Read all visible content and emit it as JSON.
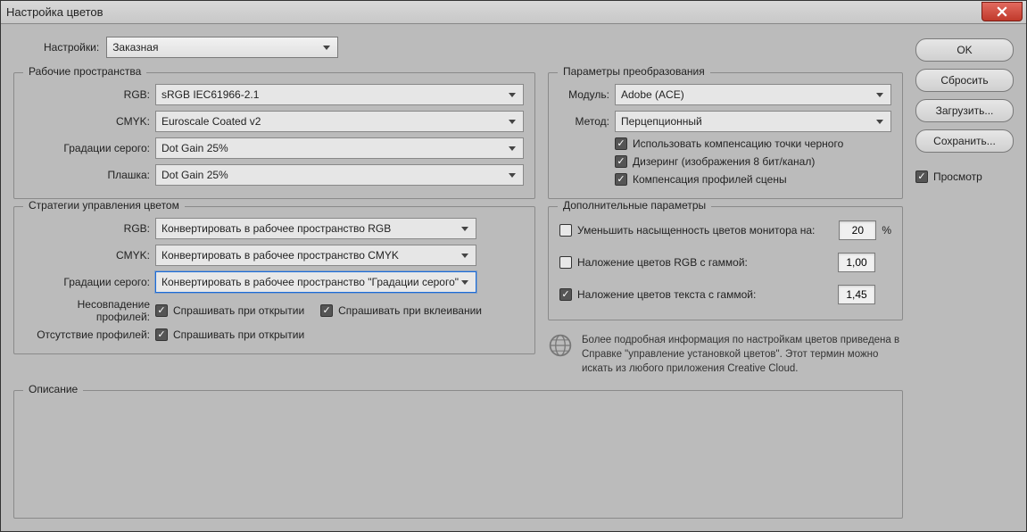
{
  "window": {
    "title": "Настройка цветов"
  },
  "buttons": {
    "ok": "OK",
    "reset": "Сбросить",
    "load": "Загрузить...",
    "save": "Сохранить...",
    "preview": "Просмотр"
  },
  "settings": {
    "label": "Настройки:",
    "value": "Заказная"
  },
  "workspaces": {
    "title": "Рабочие пространства",
    "rgb_label": "RGB:",
    "rgb_value": "sRGB IEC61966-2.1",
    "cmyk_label": "CMYK:",
    "cmyk_value": "Euroscale Coated v2",
    "gray_label": "Градации серого:",
    "gray_value": "Dot Gain 25%",
    "spot_label": "Плашка:",
    "spot_value": "Dot Gain 25%"
  },
  "policies": {
    "title": "Стратегии управления цветом",
    "rgb_label": "RGB:",
    "rgb_value": "Конвертировать в рабочее пространство RGB",
    "cmyk_label": "CMYK:",
    "cmyk_value": "Конвертировать в рабочее пространство CMYK",
    "gray_label": "Градации серого:",
    "gray_value": "Конвертировать в рабочее пространство \"Градации серого\"",
    "mismatch_label": "Несовпадение профилей:",
    "ask_open": "Спрашивать при открытии",
    "ask_paste": "Спрашивать при вклеивании",
    "missing_label": "Отсутствие профилей:"
  },
  "conversion": {
    "title": "Параметры преобразования",
    "engine_label": "Модуль:",
    "engine_value": "Adobe (ACE)",
    "intent_label": "Метод:",
    "intent_value": "Перцепционный",
    "bpc": "Использовать компенсацию точки черного",
    "dither": "Дизеринг (изображения 8 бит/канал)",
    "scene": "Компенсация профилей сцены"
  },
  "advanced": {
    "title": "Дополнительные параметры",
    "desaturate": "Уменьшить насыщенность цветов монитора на:",
    "desaturate_val": "20",
    "desaturate_unit": "%",
    "blend_rgb": "Наложение цветов RGB с гаммой:",
    "blend_rgb_val": "1,00",
    "blend_text": "Наложение цветов текста с гаммой:",
    "blend_text_val": "1,45"
  },
  "info": "Более подробная информация по настройкам цветов приведена в Справке \"управление установкой цветов\". Этот термин можно искать из любого приложения Creative Cloud.",
  "description": {
    "title": "Описание"
  }
}
